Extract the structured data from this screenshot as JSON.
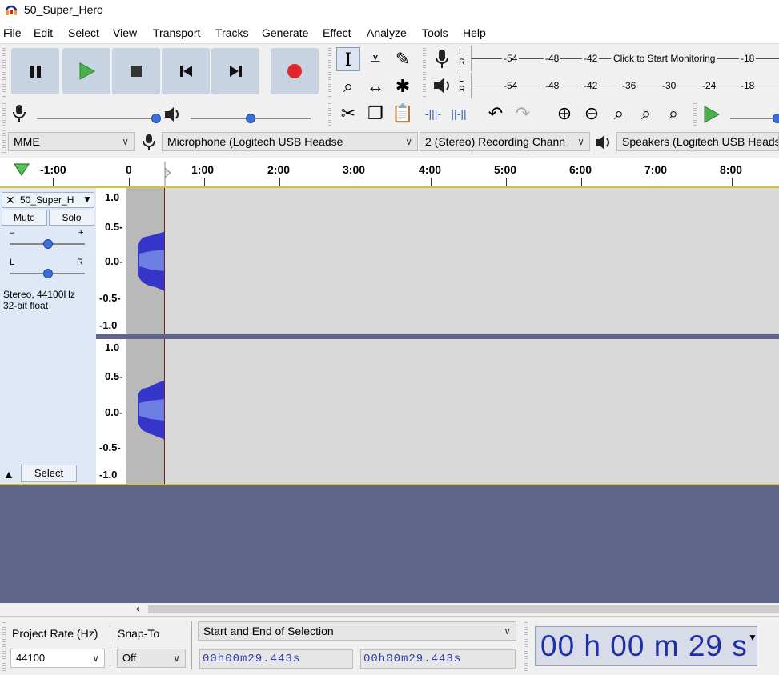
{
  "window": {
    "title": "50_Super_Hero"
  },
  "menu": [
    "File",
    "Edit",
    "Select",
    "View",
    "Transport",
    "Tracks",
    "Generate",
    "Effect",
    "Analyze",
    "Tools",
    "Help"
  ],
  "meter": {
    "rec_channels": [
      "L",
      "R"
    ],
    "play_channels": [
      "L",
      "R"
    ],
    "record_scale": [
      "-54",
      "-48",
      "-42",
      "-18"
    ],
    "record_prompt": "Click to Start Monitoring",
    "play_scale": [
      "-54",
      "-48",
      "-42",
      "-36",
      "-30",
      "-24",
      "-18"
    ]
  },
  "device": {
    "host": "MME",
    "mic": "Microphone (Logitech USB Headse",
    "channels": "2 (Stereo) Recording Chann",
    "speakers": "Speakers (Logitech USB Heads"
  },
  "ruler": {
    "labels": [
      "-1:00",
      "0",
      "1:00",
      "2:00",
      "3:00",
      "4:00",
      "5:00",
      "6:00",
      "7:00",
      "8:00"
    ]
  },
  "track": {
    "name": "50_Super_H",
    "mute": "Mute",
    "solo": "Solo",
    "gain_min": "–",
    "gain_max": "+",
    "pan_left": "L",
    "pan_right": "R",
    "info1": "Stereo, 44100Hz",
    "info2": "32-bit float",
    "select": "Select",
    "scale": [
      "1.0",
      "0.5-",
      "0.0-",
      "-0.5-",
      "-1.0"
    ]
  },
  "selectionbar": {
    "project_rate_label": "Project Rate (Hz)",
    "snap_label": "Snap-To",
    "rate_value": "44100",
    "snap_value": "Off",
    "selection_mode": "Start and End of Selection",
    "start_time": "00h00m29.443s",
    "end_time": "00h00m29.443s",
    "big_time": "00 h 00 m 29 s"
  },
  "colors": {
    "accent": "#3a6fd8",
    "waveform": "#3535c9",
    "record": "#e0262c",
    "play": "#3fae3f"
  }
}
